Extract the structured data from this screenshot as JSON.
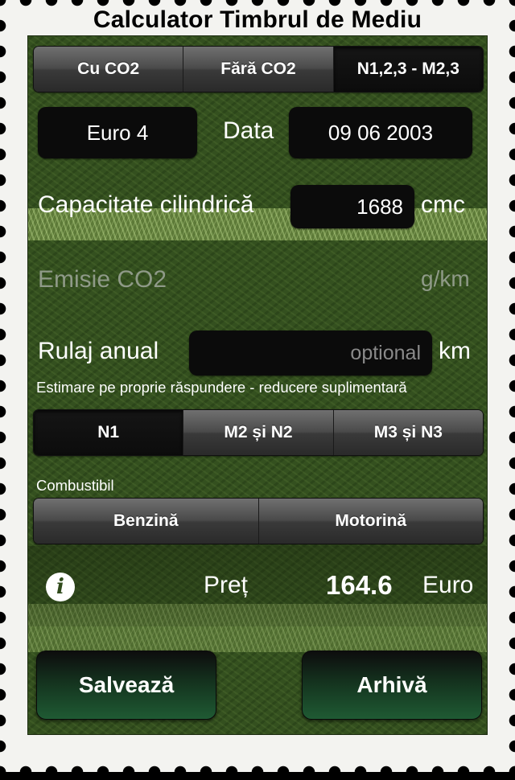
{
  "app_title": "Calculator Timbrul de Mediu",
  "tabs_top": [
    "Cu CO2",
    "Fără CO2",
    "N1,2,3 - M2,3"
  ],
  "tabs_top_selected": "N1,2,3 - M2,3",
  "euro_norm": "Euro 4",
  "date_label": "Data",
  "date_value": "09 06 2003",
  "capacity_label": "Capacitate cilindrică",
  "capacity_value": "1688",
  "capacity_unit": "cmc",
  "emission_label": "Emisie CO2",
  "emission_unit": "g/km",
  "mileage_label": "Rulaj anual",
  "mileage_placeholder": "optional",
  "mileage_unit": "km",
  "mileage_note": "Estimare pe proprie răspundere - reducere suplimentară",
  "vehicle_class_tabs": [
    "N1",
    "M2 și N2",
    "M3 și N3"
  ],
  "vehicle_class_selected": "N1",
  "fuel_label": "Combustibil",
  "fuel_tabs": [
    "Benzină",
    "Motorină"
  ],
  "price_label": "Preț",
  "price_value": "164.6",
  "price_currency": "Euro",
  "info_icon_glyph": "i",
  "save_button": "Salvează",
  "archive_button": "Arhivă",
  "colors": {
    "panel_green": "#34501f",
    "grass_light": "#5d7a38",
    "button_green": "#1f5a33",
    "stamp_white": "#f3f3f0"
  },
  "icons": {
    "info": "info-icon"
  }
}
